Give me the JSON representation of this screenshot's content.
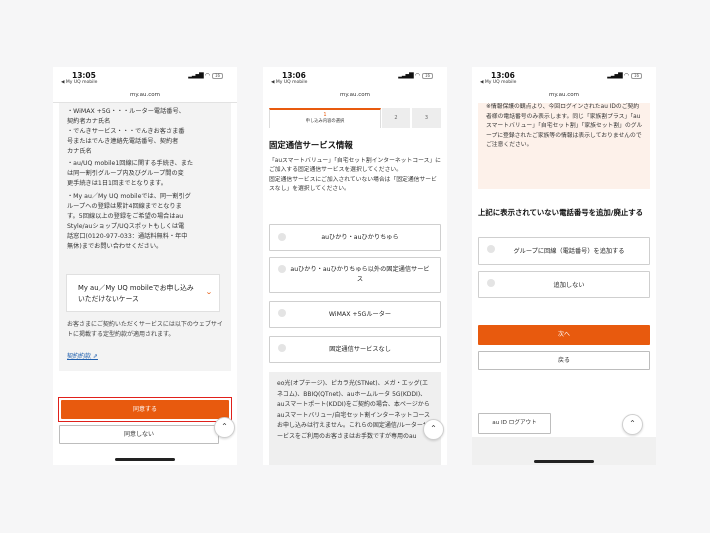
{
  "status": {
    "time": "13:05",
    "time2": "13:06",
    "time3": "13:06",
    "back_app": "◀ My UQ mobile",
    "battery": "16"
  },
  "url": "my.au.com",
  "screen1": {
    "items": [
      "・WiMAX +5G・・・ルーター電話番号、",
      "  契約者カナ氏名",
      "・でんきサービス・・・でんきお客さま番",
      "  号またはでんき連絡先電話番号、契約者",
      "  カナ氏名",
      "・au/UQ mobile1回線に関する手続き、また",
      "  は同一割引グループ内及びグループ間の変",
      "  更手続きは1日1回までとなります。",
      "・My au／My UQ mobileでは、同一割引グ",
      "  ループへの登録は累計4回線までとなりま",
      "  す。5回線以上の登録をご希望の場合はau",
      "  Style/auショップ/UQスポットもしくは電",
      "  話窓口(0120-977-033：通話料無料・年中",
      "  無休)までお問い合わせください。"
    ],
    "case_label": "My au／My UQ mobileでお申し込みいただけないケース",
    "note": "お客さまにご契約いただくサービスには以下のウェブサイトに掲載する定型約款が適用されます。",
    "terms_link": "契約約款",
    "agree_button": "同意する",
    "disagree_button": "同意しない"
  },
  "screen2": {
    "steps": [
      {
        "num": "1",
        "label": "申し込み内容の選択"
      },
      {
        "num": "2",
        "label": ""
      },
      {
        "num": "3",
        "label": ""
      }
    ],
    "title": "固定通信サービス情報",
    "desc1": "「auスマートバリュー」「自宅セット割インターネットコース」にご加入する固定通信サービスを選択してください。",
    "desc2": "固定通信サービスにご加入されていない場合は「固定通信サービスなし」を選択してください。",
    "options": [
      "auひかり・auひかりちゅら",
      "auひかり・auひかりちゅら以外の固定通信サービス",
      "WiMAX +5Gルーター",
      "固定通信サービスなし"
    ],
    "info": "eo光(オプテージ)、ピカラ光(STNet)、メガ・エッグ(エネコム)、BBIQ(QTnet)、auホームルータ 5G(KDDI)、auスマートポート(KDDI)をご契約の場合、本ページからauスマートバリュー/自宅セット割インターネットコースお申し込みは行えません。これらの固定通信/ルーターサービスをご利用のお客さまはお手数ですが専用のau"
  },
  "screen3": {
    "notice": "※情報保護の観点より、今回ログインされたau IDのご契約者様の電話番号のみ表示します。同じ「家族割プラス」「auスマートバリュー」「自宅セット割」「家族セット割」のグループに登録されたご家族等の情報は表示しておりませんのでご注意ください。",
    "title": "上記に表示されていない電話番号を追加/廃止する",
    "options": [
      "グループに回線（電話番号）を追加する",
      "追加しない"
    ],
    "next_button": "次へ",
    "back_button": "戻る",
    "logout_button": "au ID ログアウト"
  }
}
